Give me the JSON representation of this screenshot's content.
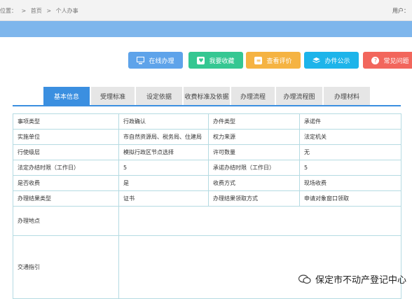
{
  "topbar": {
    "location_label": "位置：",
    "separator": ">",
    "home": "首页",
    "current": "个人办事",
    "user_label": "用户："
  },
  "actions": [
    {
      "label": "在线办理",
      "color": "#5ea3ea",
      "icon": "monitor-icon"
    },
    {
      "label": "我要收藏",
      "color": "#35c792",
      "icon": "heart-icon"
    },
    {
      "label": "查看评价",
      "color": "#f5b342",
      "icon": "comment-icon"
    },
    {
      "label": "办件公示",
      "color": "#1db4ea",
      "icon": "layers-icon"
    },
    {
      "label": "常见问题",
      "color": "#f2665c",
      "icon": "question-icon"
    }
  ],
  "tabs": [
    "基本信息",
    "受理标准",
    "设定依据",
    "收费标准及依据",
    "办理流程",
    "办理流程图",
    "办理材料"
  ],
  "table": {
    "rows": [
      [
        "事项类型",
        "行政确认",
        "办件类型",
        "承诺件"
      ],
      [
        "实施单位",
        "市自然资源局、税务局、住建局",
        "权力来源",
        "法定机关"
      ],
      [
        "行使级层",
        "模拟行政区节点选择",
        "许可数量",
        "无"
      ],
      [
        "法定办结时限（工作日）",
        "5",
        "承诺办结时限（工作日）",
        "5"
      ],
      [
        "是否收费",
        "是",
        "收费方式",
        "现场收费"
      ],
      [
        "办理结果类型",
        "证书",
        "办理结果领取方式",
        "申请对象窗口领取"
      ]
    ],
    "location_label": "办理地点",
    "traffic_label": "交通指引"
  },
  "watermark": "保定市不动产登记中心"
}
